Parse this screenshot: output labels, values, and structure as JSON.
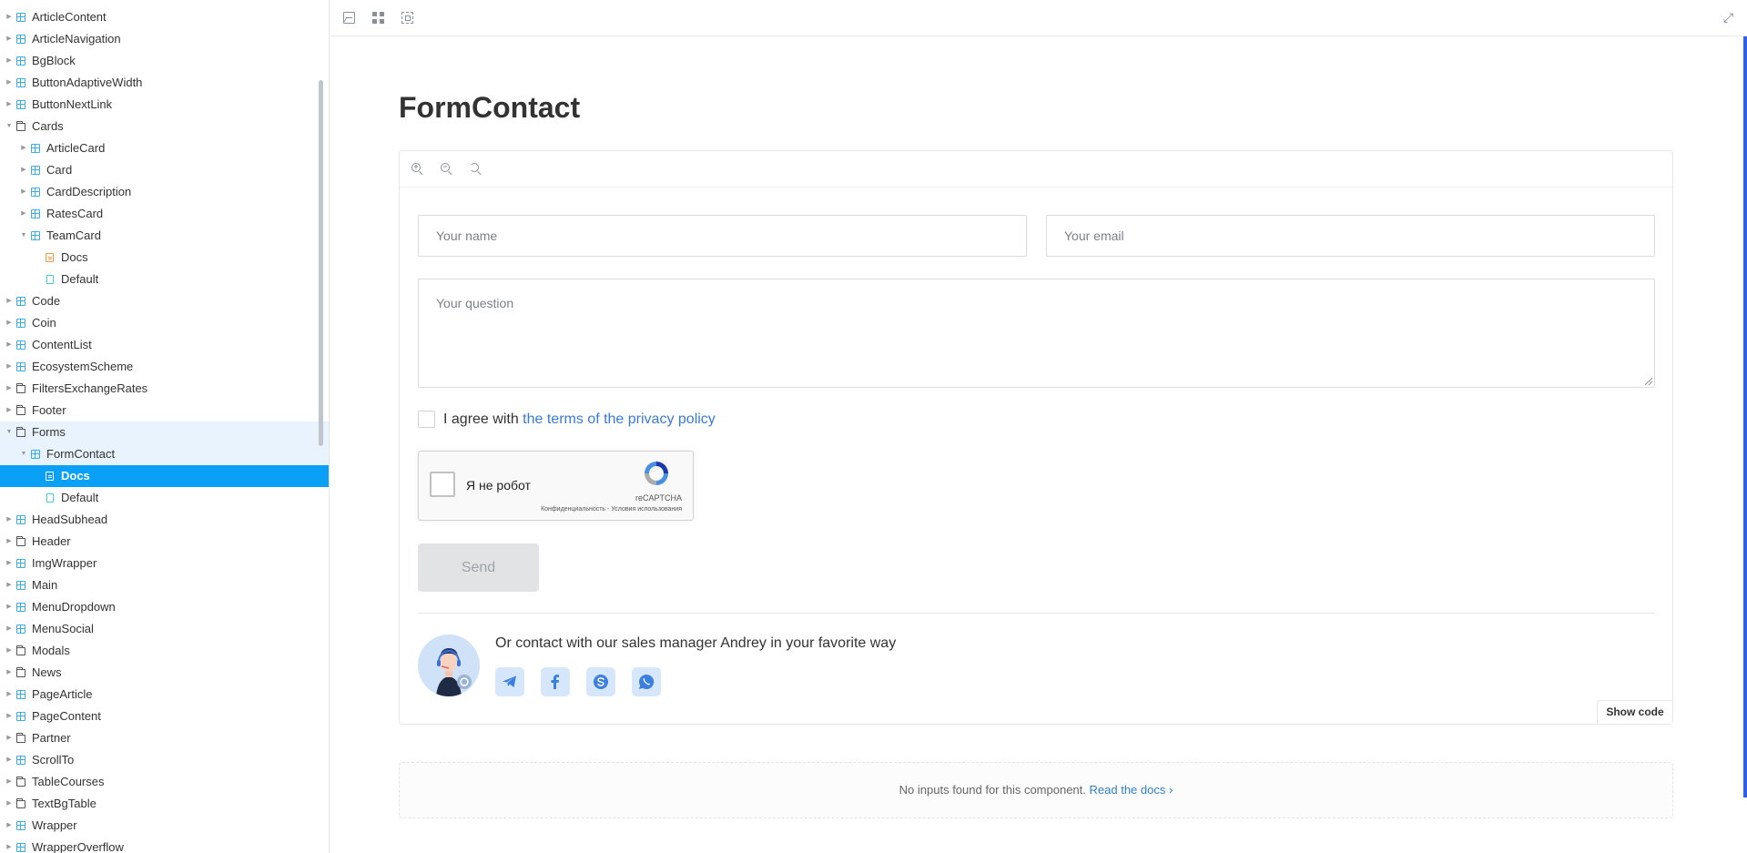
{
  "sidebar": {
    "items": [
      {
        "label": "ArticleContent",
        "icon": "component-icon",
        "depth": 0,
        "state": "collapsed"
      },
      {
        "label": "ArticleNavigation",
        "icon": "component-icon",
        "depth": 0,
        "state": "collapsed"
      },
      {
        "label": "BgBlock",
        "icon": "component-icon",
        "depth": 0,
        "state": "collapsed"
      },
      {
        "label": "ButtonAdaptiveWidth",
        "icon": "component-icon",
        "depth": 0,
        "state": "collapsed"
      },
      {
        "label": "ButtonNextLink",
        "icon": "component-icon",
        "depth": 0,
        "state": "collapsed"
      },
      {
        "label": "Cards",
        "icon": "folder-icon",
        "depth": 0,
        "state": "expanded"
      },
      {
        "label": "ArticleCard",
        "icon": "component-icon",
        "depth": 1,
        "state": "collapsed"
      },
      {
        "label": "Card",
        "icon": "component-icon",
        "depth": 1,
        "state": "collapsed"
      },
      {
        "label": "CardDescription",
        "icon": "component-icon",
        "depth": 1,
        "state": "collapsed"
      },
      {
        "label": "RatesCard",
        "icon": "component-icon",
        "depth": 1,
        "state": "collapsed"
      },
      {
        "label": "TeamCard",
        "icon": "component-icon",
        "depth": 1,
        "state": "expanded"
      },
      {
        "label": "Docs",
        "icon": "doc-icon",
        "depth": 2,
        "state": "leaf"
      },
      {
        "label": "Default",
        "icon": "story-icon",
        "depth": 2,
        "state": "leaf"
      },
      {
        "label": "Code",
        "icon": "component-icon",
        "depth": 0,
        "state": "collapsed"
      },
      {
        "label": "Coin",
        "icon": "component-icon",
        "depth": 0,
        "state": "collapsed"
      },
      {
        "label": "ContentList",
        "icon": "component-icon",
        "depth": 0,
        "state": "collapsed"
      },
      {
        "label": "EcosystemScheme",
        "icon": "component-icon",
        "depth": 0,
        "state": "collapsed"
      },
      {
        "label": "FiltersExchangeRates",
        "icon": "folder-icon",
        "depth": 0,
        "state": "collapsed"
      },
      {
        "label": "Footer",
        "icon": "folder-icon",
        "depth": 0,
        "state": "collapsed"
      },
      {
        "label": "Forms",
        "icon": "folder-icon",
        "depth": 0,
        "state": "expanded",
        "highlight": true
      },
      {
        "label": "FormContact",
        "icon": "component-icon",
        "depth": 1,
        "state": "expanded",
        "highlight": true
      },
      {
        "label": "Docs",
        "icon": "doc-icon",
        "depth": 2,
        "state": "leaf",
        "selected": true
      },
      {
        "label": "Default",
        "icon": "story-icon",
        "depth": 2,
        "state": "leaf"
      },
      {
        "label": "HeadSubhead",
        "icon": "component-icon",
        "depth": 0,
        "state": "collapsed"
      },
      {
        "label": "Header",
        "icon": "folder-icon",
        "depth": 0,
        "state": "collapsed"
      },
      {
        "label": "ImgWrapper",
        "icon": "component-icon",
        "depth": 0,
        "state": "collapsed"
      },
      {
        "label": "Main",
        "icon": "component-icon",
        "depth": 0,
        "state": "collapsed"
      },
      {
        "label": "MenuDropdown",
        "icon": "component-icon",
        "depth": 0,
        "state": "collapsed"
      },
      {
        "label": "MenuSocial",
        "icon": "component-icon",
        "depth": 0,
        "state": "collapsed"
      },
      {
        "label": "Modals",
        "icon": "folder-icon",
        "depth": 0,
        "state": "collapsed"
      },
      {
        "label": "News",
        "icon": "folder-icon",
        "depth": 0,
        "state": "collapsed"
      },
      {
        "label": "PageArticle",
        "icon": "component-icon",
        "depth": 0,
        "state": "collapsed"
      },
      {
        "label": "PageContent",
        "icon": "component-icon",
        "depth": 0,
        "state": "collapsed"
      },
      {
        "label": "Partner",
        "icon": "folder-icon",
        "depth": 0,
        "state": "collapsed"
      },
      {
        "label": "ScrollTo",
        "icon": "component-icon",
        "depth": 0,
        "state": "collapsed"
      },
      {
        "label": "TableCourses",
        "icon": "folder-icon",
        "depth": 0,
        "state": "collapsed"
      },
      {
        "label": "TextBgTable",
        "icon": "folder-icon",
        "depth": 0,
        "state": "collapsed"
      },
      {
        "label": "Wrapper",
        "icon": "component-icon",
        "depth": 0,
        "state": "collapsed"
      },
      {
        "label": "WrapperOverflow",
        "icon": "component-icon",
        "depth": 0,
        "state": "collapsed"
      }
    ]
  },
  "toolbar": {
    "icons": [
      "image-icon",
      "grid-icon",
      "outline-icon",
      "fullscreen-icon"
    ]
  },
  "page": {
    "title": "FormContact"
  },
  "preview": {
    "zoom_icons": [
      "zoom-in-icon",
      "zoom-out-icon",
      "zoom-reset-icon"
    ],
    "form": {
      "name_placeholder": "Your name",
      "email_placeholder": "Your email",
      "question_placeholder": "Your question",
      "agree_prefix": "I agree with ",
      "agree_link": "the terms of the privacy policy",
      "captcha_label": "Я не робот",
      "captcha_brand": "reCAPTCHA",
      "captcha_terms": "Конфиденциальность - Условия использования",
      "send_label": "Send"
    },
    "contact": {
      "text": "Or contact with our sales manager Andrey in your favorite way",
      "socials": [
        "telegram-icon",
        "facebook-icon",
        "skype-icon",
        "whatsapp-icon"
      ]
    },
    "show_code_label": "Show code"
  },
  "docs": {
    "no_inputs_text": "No inputs found for this component.",
    "read_docs_link": "Read the docs",
    "read_docs_chevron": "›"
  },
  "colors": {
    "accent": "#0aa0f5",
    "link": "#3a7bd5",
    "right_accent": "#2f5ff0"
  }
}
